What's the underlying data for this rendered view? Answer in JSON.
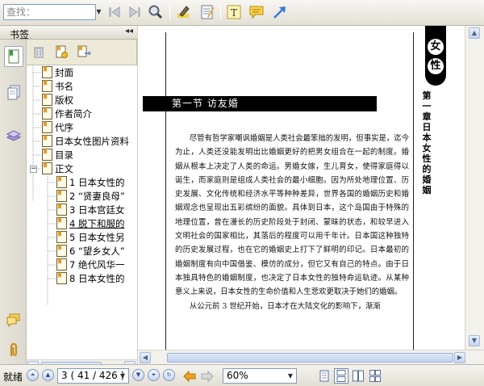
{
  "toolbar": {
    "search_placeholder": "查找：",
    "icons": [
      "search-prev-icon",
      "search-next-icon",
      "search-icon",
      "highlight-pen-icon",
      "note-pad-icon",
      "text-tool-icon",
      "comment-icon",
      "arrow-tool-icon"
    ]
  },
  "sidebar": {
    "title": "书签",
    "collapse_glyph": "◂◂",
    "strip_icons": [
      "bookmark-panel-icon",
      "pages-panel-icon",
      "layers-panel-icon",
      "comments-panel-icon",
      "attachments-panel-icon"
    ],
    "bookmark_tools": [
      "delete-bookmark-icon",
      "new-bookmark-icon",
      "move-bookmark-icon"
    ],
    "bookmarks": [
      {
        "label": "封面"
      },
      {
        "label": "书名"
      },
      {
        "label": "版权"
      },
      {
        "label": "作者简介"
      },
      {
        "label": "代序"
      },
      {
        "label": "日本女性图片资料"
      },
      {
        "label": "目录"
      },
      {
        "label": "正文"
      },
      {
        "label": "1  日本女性的"
      },
      {
        "label": "2  “贤妻良母”"
      },
      {
        "label": "3  日本宫廷女"
      },
      {
        "label": "4  脱下和服的"
      },
      {
        "label": "5  日本女性另"
      },
      {
        "label": "6  “望乡女人”"
      },
      {
        "label": "7  绝代风华一"
      },
      {
        "label": "8  日本女性的"
      }
    ],
    "expander": "−"
  },
  "document": {
    "section_title": "第一节  访友婚",
    "side_tab": [
      "女",
      "性"
    ],
    "chapter_vertical": "第一章  日本女性的婚姻",
    "paragraphs": [
      "尽管有哲学家嘲讽婚姻是人类社会最笨拙的发明，但事实是，迄今为止，人类还没能发明出比婚姻更好的把男女组合在一起的制度。婚姻从根本上决定了人类的命运。男婚女嫁，生儿育女，使得家庭得以诞生，而家庭则是组成人类社会的最小细胞。因为所处地理位置、历史发展、文化传统和经济水平等种种差异，世界各国的婚姻历史和婚姻观念也呈现出五彩缤纷的面貌。具体到日本，这个岛国由于特殊的地理位置，曾在漫长的历史阶段处于封闭、蒙昧的状态，和较早进入文明社会的国家相比，其落后的程度可以用千年计。日本国这种独特的历史发展过程，也在它的婚姻史上打下了鲜明的印记。日本最初的婚姻制度有向中国借鉴、模仿的成分，但它又有自己的特点。由于日本独具特色的婚姻制度，也决定了日本女性的独特命运轨迹。从某种意义上来说，日本女性的生命价值和人生悲欢更取决于她们的婚姻。",
      "从公元前 3 世纪开始，日本才在大陆文化的影响下，渐渐"
    ]
  },
  "statusbar": {
    "status": "就绪",
    "page_field": "3  ( 41 / 426 )",
    "zoom_field": "60%",
    "nav_icons": [
      "first-page-icon",
      "prev-page-icon",
      "next-page-icon",
      "last-page-icon",
      "back-icon",
      "forward-icon"
    ],
    "view_icons": [
      "single-page-view-icon",
      "continuous-view-icon",
      "facing-view-icon",
      "continuous-facing-view-icon"
    ]
  }
}
